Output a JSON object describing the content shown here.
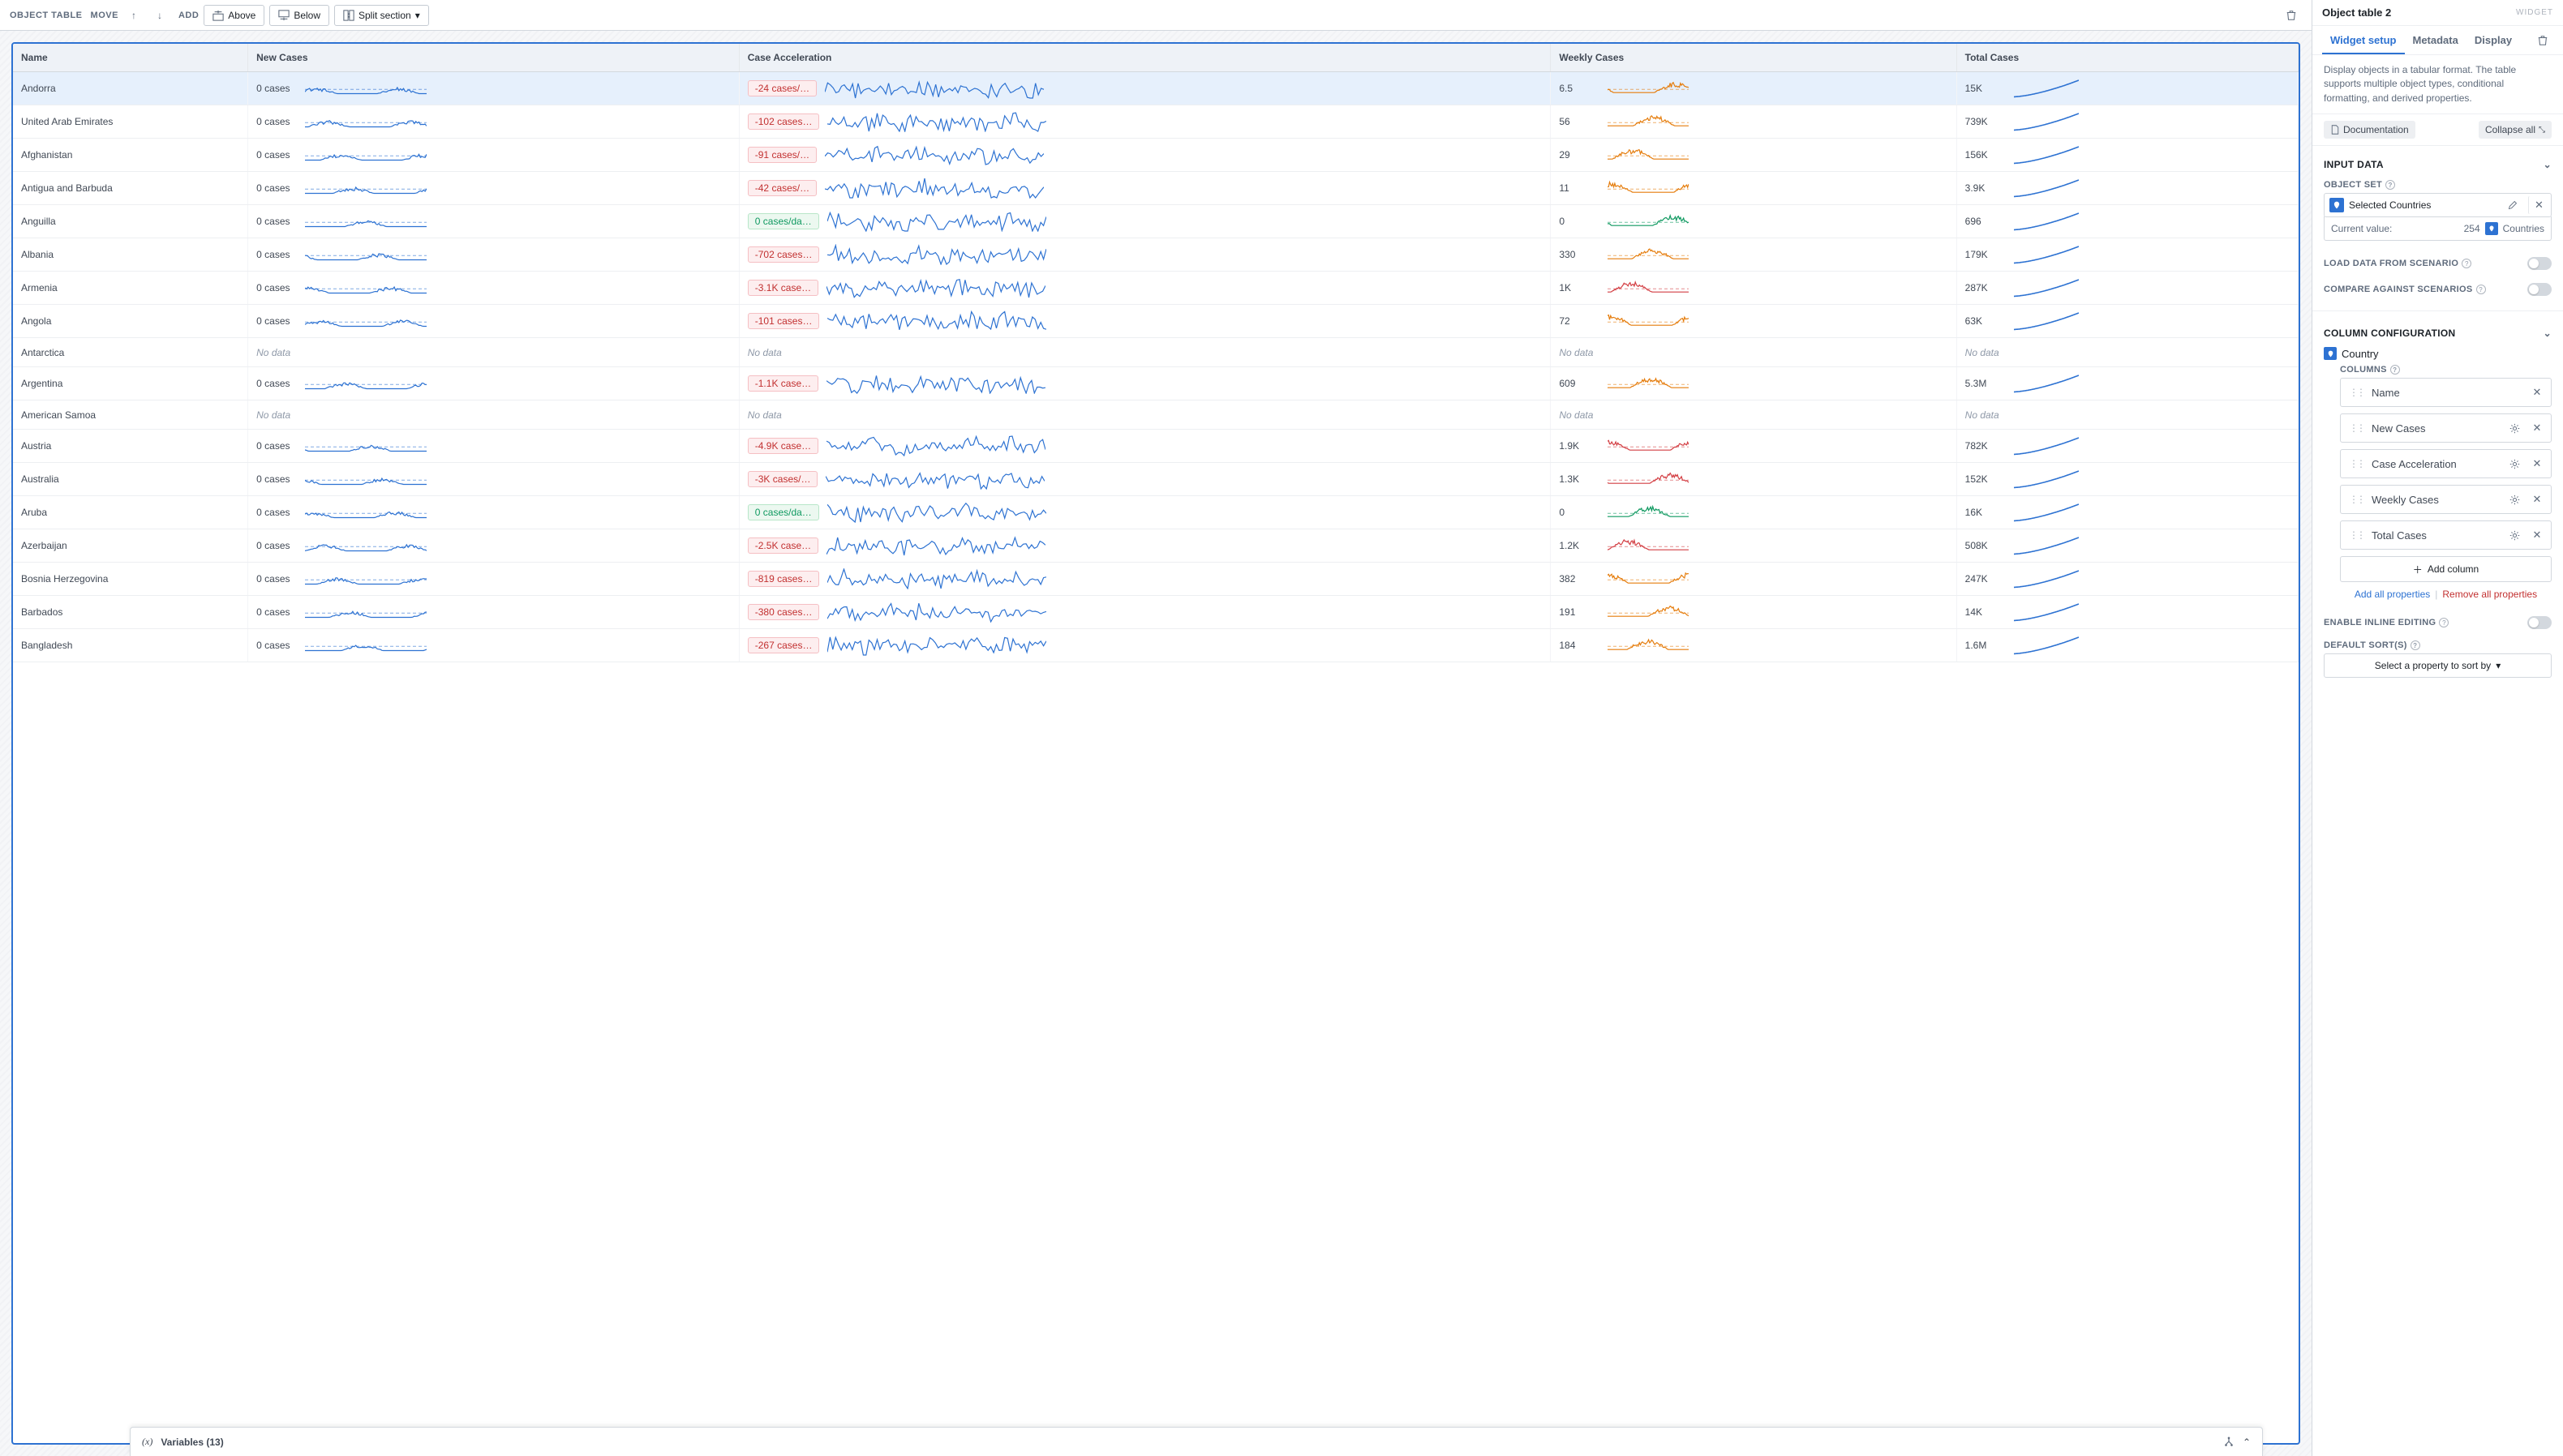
{
  "toolbar": {
    "object_table_label": "OBJECT TABLE",
    "move_label": "MOVE",
    "add_label": "ADD",
    "above_label": "Above",
    "below_label": "Below",
    "split_section_label": "Split section"
  },
  "table": {
    "columns": [
      "Name",
      "New Cases",
      "Case Acceleration",
      "Weekly Cases",
      "Total Cases"
    ],
    "rows": [
      {
        "name": "Andorra",
        "new_cases": "0 cases",
        "accel": "-24 cases/…",
        "accel_tone": "neg",
        "weekly": "6.5",
        "weekly_tone": "orange",
        "total": "15K",
        "selected": true
      },
      {
        "name": "United Arab Emirates",
        "new_cases": "0 cases",
        "accel": "-102 cases…",
        "accel_tone": "neg",
        "weekly": "56",
        "weekly_tone": "orange",
        "total": "739K"
      },
      {
        "name": "Afghanistan",
        "new_cases": "0 cases",
        "accel": "-91 cases/…",
        "accel_tone": "neg",
        "weekly": "29",
        "weekly_tone": "orange",
        "total": "156K"
      },
      {
        "name": "Antigua and Barbuda",
        "new_cases": "0 cases",
        "accel": "-42 cases/…",
        "accel_tone": "neg",
        "weekly": "11",
        "weekly_tone": "orange",
        "total": "3.9K"
      },
      {
        "name": "Anguilla",
        "new_cases": "0 cases",
        "accel": "0 cases/da…",
        "accel_tone": "zero",
        "weekly": "0",
        "weekly_tone": "green",
        "total": "696"
      },
      {
        "name": "Albania",
        "new_cases": "0 cases",
        "accel": "-702 cases…",
        "accel_tone": "neg",
        "weekly": "330",
        "weekly_tone": "orange",
        "total": "179K"
      },
      {
        "name": "Armenia",
        "new_cases": "0 cases",
        "accel": "-3.1K case…",
        "accel_tone": "neg",
        "weekly": "1K",
        "weekly_tone": "red",
        "total": "287K"
      },
      {
        "name": "Angola",
        "new_cases": "0 cases",
        "accel": "-101 cases…",
        "accel_tone": "neg",
        "weekly": "72",
        "weekly_tone": "orange",
        "total": "63K"
      },
      {
        "name": "Antarctica",
        "nodata": true
      },
      {
        "name": "Argentina",
        "new_cases": "0 cases",
        "accel": "-1.1K case…",
        "accel_tone": "neg",
        "weekly": "609",
        "weekly_tone": "orange",
        "total": "5.3M"
      },
      {
        "name": "American Samoa",
        "nodata": true
      },
      {
        "name": "Austria",
        "new_cases": "0 cases",
        "accel": "-4.9K case…",
        "accel_tone": "neg",
        "weekly": "1.9K",
        "weekly_tone": "red",
        "total": "782K"
      },
      {
        "name": "Australia",
        "new_cases": "0 cases",
        "accel": "-3K cases/…",
        "accel_tone": "neg",
        "weekly": "1.3K",
        "weekly_tone": "red",
        "total": "152K"
      },
      {
        "name": "Aruba",
        "new_cases": "0 cases",
        "accel": "0 cases/da…",
        "accel_tone": "zero",
        "weekly": "0",
        "weekly_tone": "green",
        "total": "16K"
      },
      {
        "name": "Azerbaijan",
        "new_cases": "0 cases",
        "accel": "-2.5K case…",
        "accel_tone": "neg",
        "weekly": "1.2K",
        "weekly_tone": "red",
        "total": "508K"
      },
      {
        "name": "Bosnia Herzegovina",
        "new_cases": "0 cases",
        "accel": "-819 cases…",
        "accel_tone": "neg",
        "weekly": "382",
        "weekly_tone": "orange",
        "total": "247K"
      },
      {
        "name": "Barbados",
        "new_cases": "0 cases",
        "accel": "-380 cases…",
        "accel_tone": "neg",
        "weekly": "191",
        "weekly_tone": "orange",
        "total": "14K"
      },
      {
        "name": "Bangladesh",
        "new_cases": "0 cases",
        "accel": "-267 cases…",
        "accel_tone": "neg",
        "weekly": "184",
        "weekly_tone": "orange",
        "total": "1.6M"
      }
    ],
    "no_data_text": "No data"
  },
  "variables_bar": {
    "label": "Variables (13)"
  },
  "side": {
    "title": "Object table 2",
    "type_label": "WIDGET",
    "tabs": {
      "setup": "Widget setup",
      "metadata": "Metadata",
      "display": "Display"
    },
    "description": "Display objects in a tabular format. The table supports multiple object types, conditional formatting, and derived properties.",
    "documentation_label": "Documentation",
    "collapse_all_label": "Collapse all",
    "input_data": {
      "heading": "INPUT DATA",
      "object_set_label": "OBJECT SET",
      "selected_name": "Selected Countries",
      "current_value_label": "Current value:",
      "current_value_count": "254",
      "current_value_type": "Countries",
      "load_scenario_label": "LOAD DATA FROM SCENARIO",
      "compare_scenarios_label": "COMPARE AGAINST SCENARIOS"
    },
    "column_config": {
      "heading": "COLUMN CONFIGURATION",
      "object_type_label": "Country",
      "columns_label": "COLUMNS",
      "items": [
        {
          "label": "Name",
          "gear": false
        },
        {
          "label": "New Cases",
          "gear": true
        },
        {
          "label": "Case Acceleration",
          "gear": true
        },
        {
          "label": "Weekly Cases",
          "gear": true
        },
        {
          "label": "Total Cases",
          "gear": true
        }
      ],
      "add_column_label": "Add column",
      "add_all_label": "Add all properties",
      "remove_all_label": "Remove all properties",
      "inline_editing_label": "ENABLE INLINE EDITING",
      "default_sort_label": "DEFAULT SORT(S)",
      "sort_placeholder": "Select a property to sort by"
    }
  }
}
